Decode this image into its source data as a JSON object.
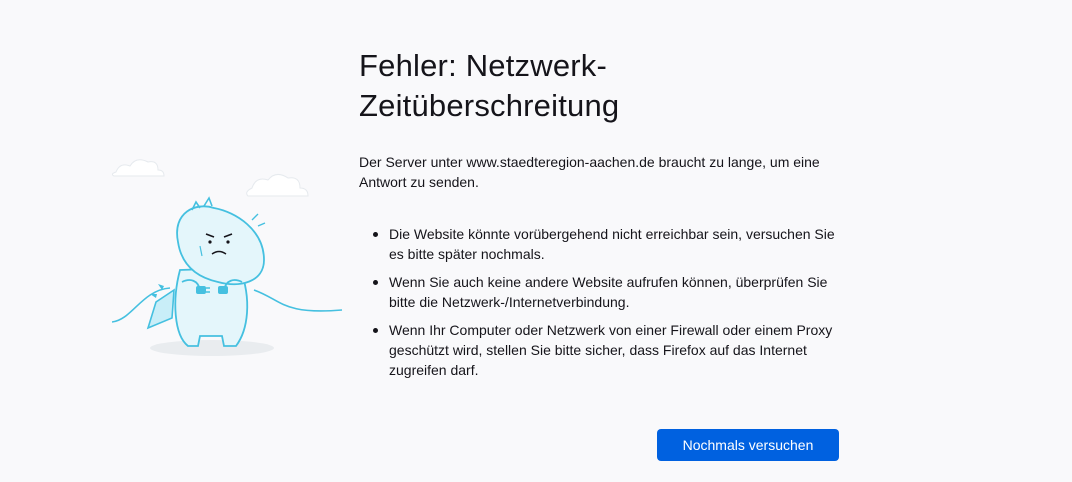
{
  "error": {
    "title": "Fehler: Netzwerk-Zeitüberschreitung",
    "description": "Der Server unter www.staedteregion-aachen.de braucht zu lange, um eine Antwort zu senden.",
    "tips": [
      "Die Website könnte vorübergehend nicht erreichbar sein, versuchen Sie es bitte später nochmals.",
      "Wenn Sie auch keine andere Website aufrufen können, überprüfen Sie bitte die Netzwerk-/Internetverbindung.",
      "Wenn Ihr Computer oder Netzwerk von einer Firewall oder einem Proxy geschützt wird, stellen Sie bitte sicher, dass Firefox auf das Internet zugreifen darf."
    ],
    "retry_label": "Nochmals versuchen"
  },
  "colors": {
    "background": "#f9f9fb",
    "accent": "#0061e0",
    "illustration_line": "#45c0e0",
    "illustration_fill": "#e4f6fb"
  },
  "icons": {
    "illustration": "dino-unplugged-illustration"
  }
}
